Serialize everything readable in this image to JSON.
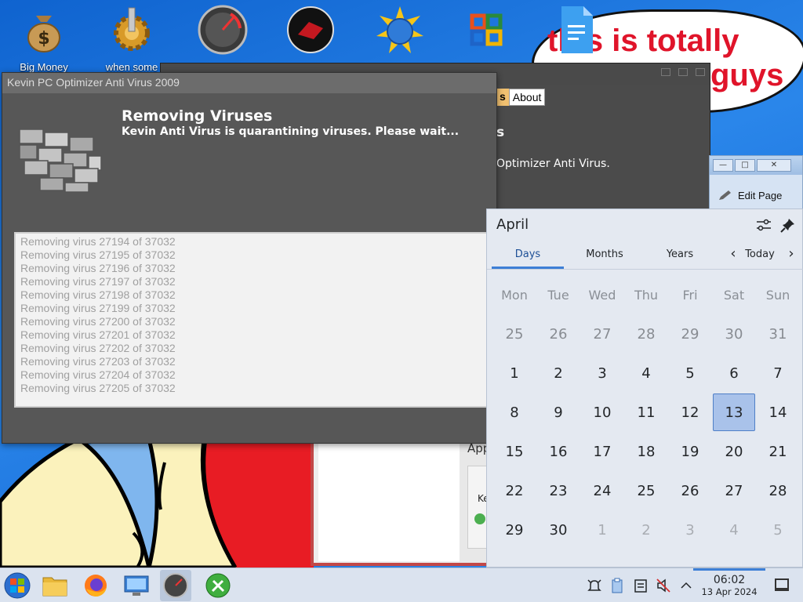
{
  "desktop": {
    "icons": [
      {
        "name": "money-bag-icon",
        "label": "Big Money"
      },
      {
        "name": "gear-icon",
        "label": "when some"
      },
      {
        "name": "speedometer-icon",
        "label": ""
      },
      {
        "name": "red-circle-icon",
        "label": ""
      },
      {
        "name": "globe-icon",
        "label": ""
      },
      {
        "name": "office-logo-icon",
        "label": ""
      },
      {
        "name": "document-icon",
        "label": ""
      }
    ],
    "cloud_text_line1": "this is totally",
    "cloud_text_line2": "guys"
  },
  "background_window": {
    "tab_partial": "s",
    "tab_about": "About",
    "heading_partial": "s",
    "subtext_partial": "Optimizer Anti Virus."
  },
  "browser_fragment": {
    "edit_page": "Edit Page",
    "minimize": "—",
    "maximize": "□",
    "close": "✕"
  },
  "lower_fragment": {
    "app_label": "App",
    "card_text": "Ke"
  },
  "antivirus_dialog": {
    "title": "Kevin PC Optimizer Anti Virus 2009",
    "heading": "Removing Viruses",
    "status": "Kevin Anti Virus is quarantining viruses. Please wait...",
    "log": [
      "Removing virus 27194 of 37032",
      "Removing virus 27195 of 37032",
      "Removing virus 27196 of 37032",
      "Removing virus 27197 of 37032",
      "Removing virus 27198 of 37032",
      "Removing virus 27199 of 37032",
      "Removing virus 27200 of 37032",
      "Removing virus 27201 of 37032",
      "Removing virus 27202 of 37032",
      "Removing virus 27203 of 37032",
      "Removing virus 27204 of 37032",
      "Removing virus 27205 of 37032"
    ]
  },
  "calendar": {
    "month": "April",
    "tabs": {
      "days": "Days",
      "months": "Months",
      "years": "Years"
    },
    "today_label": "Today",
    "weekdays": [
      "Mon",
      "Tue",
      "Wed",
      "Thu",
      "Fri",
      "Sat",
      "Sun"
    ],
    "weeks": [
      [
        "25",
        "26",
        "27",
        "28",
        "29",
        "30",
        "31"
      ],
      [
        "1",
        "2",
        "3",
        "4",
        "5",
        "6",
        "7"
      ],
      [
        "8",
        "9",
        "10",
        "11",
        "12",
        "13",
        "14"
      ],
      [
        "15",
        "16",
        "17",
        "18",
        "19",
        "20",
        "21"
      ],
      [
        "22",
        "23",
        "24",
        "25",
        "26",
        "27",
        "28"
      ],
      [
        "29",
        "30",
        "1",
        "2",
        "3",
        "4",
        "5"
      ]
    ],
    "selected_day": "13"
  },
  "taskbar": {
    "apps": [
      "start-menu-icon",
      "file-manager-icon",
      "firefox-icon",
      "system-settings-icon",
      "speedometer-app-icon",
      "tools-app-icon"
    ],
    "tray": [
      "notifications-icon",
      "clipboard-icon",
      "storage-icon",
      "volume-muted-icon",
      "tray-expand-icon"
    ],
    "clock_time": "06:02",
    "clock_date": "13 Apr 2024"
  },
  "colors": {
    "calendar_accent": "#3d7fd6",
    "selected_day_bg": "#a9c2ea",
    "cloud_text": "#e0142a",
    "dialog_bg": "#575757"
  }
}
